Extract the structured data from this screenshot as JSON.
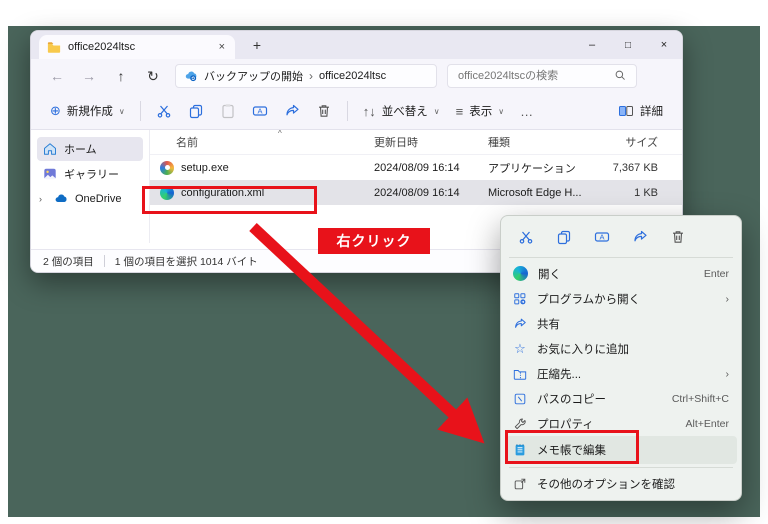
{
  "colors": {
    "desktop_bg": "#4a655b",
    "annotation_red": "#e8121a",
    "icon_accent_blue": "#2d6fdd",
    "selected_row": "#e3e3e8"
  },
  "glyphs": {
    "minimize": "–",
    "maximize": "□",
    "close": "×",
    "tab_close": "×",
    "new_tab": "+",
    "back": "←",
    "forward": "→",
    "up": "↑",
    "refresh": "↻",
    "crumb_sep": "›",
    "chevron_down": "∨",
    "new_plus": "⊕",
    "sort": "↑↓",
    "view": "≡",
    "more": "…",
    "star": "☆",
    "caret_sort": "^",
    "submenu": "›",
    "expander": "›"
  },
  "window": {
    "tab_title": "office2024ltsc"
  },
  "address": {
    "breadcrumb": [
      "バックアップの開始",
      "office2024ltsc"
    ],
    "search_placeholder": "office2024ltscの検索"
  },
  "toolbar": {
    "new_label": "新規作成",
    "sort_label": "並べ替え",
    "view_label": "表示",
    "details_label": "詳細"
  },
  "sidebar": {
    "items": [
      {
        "label": "ホーム",
        "selected": true
      },
      {
        "label": "ギャラリー",
        "selected": false
      },
      {
        "label": "OneDrive",
        "selected": false
      }
    ]
  },
  "files": {
    "columns": [
      "名前",
      "更新日時",
      "種類",
      "サイズ"
    ],
    "rows": [
      {
        "name": "setup.exe",
        "modified": "2024/08/09 16:14",
        "type": "アプリケーション",
        "size": "7,367 KB"
      },
      {
        "name": "configuration.xml",
        "modified": "2024/08/09 16:14",
        "type": "Microsoft Edge H...",
        "size": "1 KB"
      }
    ]
  },
  "statusbar": {
    "items_count": "2 個の項目",
    "selection": "1 個の項目を選択 1014 バイト"
  },
  "context_menu": {
    "items": [
      {
        "label": "開く",
        "shortcut": "Enter"
      },
      {
        "label": "プログラムから開く",
        "shortcut": "›"
      },
      {
        "label": "共有",
        "shortcut": ""
      },
      {
        "label": "お気に入りに追加",
        "shortcut": ""
      },
      {
        "label": "圧縮先...",
        "shortcut": "›"
      },
      {
        "label": "パスのコピー",
        "shortcut": "Ctrl+Shift+C"
      },
      {
        "label": "プロパティ",
        "shortcut": "Alt+Enter"
      },
      {
        "label": "メモ帳で編集",
        "shortcut": ""
      },
      {
        "label": "その他のオプションを確認",
        "shortcut": ""
      }
    ]
  },
  "annotations": {
    "right_click_label": "右クリック"
  }
}
